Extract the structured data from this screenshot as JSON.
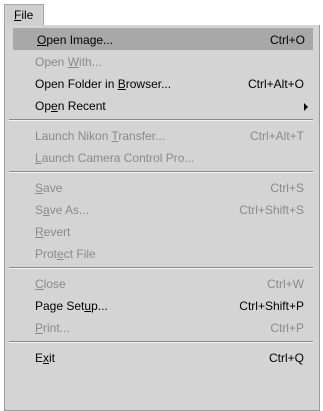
{
  "menubar": {
    "file_prefix": "",
    "file_mnemonic": "F",
    "file_rest": "ile"
  },
  "menu": {
    "groups": [
      [
        {
          "pre": "",
          "mn": "O",
          "post": "pen Image...",
          "shortcut": "Ctrl+O",
          "enabled": true,
          "highlighted": true
        },
        {
          "pre": "Open ",
          "mn": "W",
          "post": "ith...",
          "shortcut": "",
          "enabled": false
        },
        {
          "pre": "Open Folder in ",
          "mn": "B",
          "post": "rowser...",
          "shortcut": "Ctrl+Alt+O",
          "enabled": true
        },
        {
          "pre": "Op",
          "mn": "e",
          "post": "n Recent",
          "shortcut": "",
          "enabled": true,
          "submenu": true
        }
      ],
      [
        {
          "pre": "Launch Nikon ",
          "mn": "T",
          "post": "ransfer...",
          "shortcut": "Ctrl+Alt+T",
          "enabled": false
        },
        {
          "pre": "",
          "mn": "L",
          "post": "aunch Camera Control Pro...",
          "shortcut": "",
          "enabled": false
        }
      ],
      [
        {
          "pre": "",
          "mn": "S",
          "post": "ave",
          "shortcut": "Ctrl+S",
          "enabled": false
        },
        {
          "pre": "S",
          "mn": "a",
          "post": "ve As...",
          "shortcut": "Ctrl+Shift+S",
          "enabled": false
        },
        {
          "pre": "",
          "mn": "R",
          "post": "evert",
          "shortcut": "",
          "enabled": false
        },
        {
          "pre": "Prot",
          "mn": "e",
          "post": "ct File",
          "shortcut": "",
          "enabled": false
        }
      ],
      [
        {
          "pre": "",
          "mn": "C",
          "post": "lose",
          "shortcut": "Ctrl+W",
          "enabled": false
        },
        {
          "pre": "Page Set",
          "mn": "u",
          "post": "p...",
          "shortcut": "Ctrl+Shift+P",
          "enabled": true
        },
        {
          "pre": "",
          "mn": "P",
          "post": "rint...",
          "shortcut": "Ctrl+P",
          "enabled": false
        }
      ],
      [
        {
          "pre": "E",
          "mn": "x",
          "post": "it",
          "shortcut": "Ctrl+Q",
          "enabled": true
        }
      ]
    ]
  }
}
